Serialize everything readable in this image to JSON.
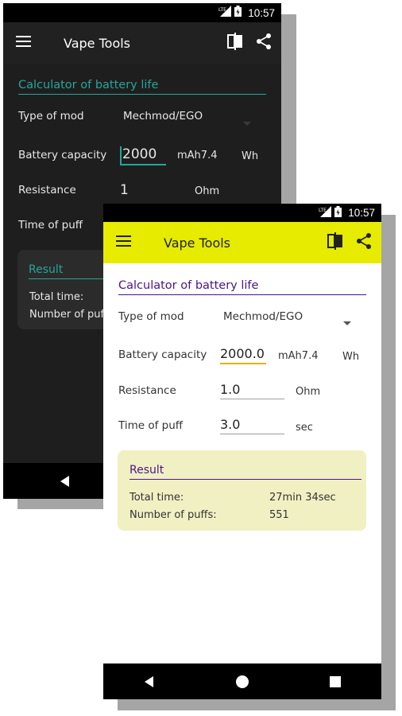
{
  "dark_screen": {
    "status_bar": {
      "time": "10:57",
      "network": "LTE"
    },
    "app_title": "Vape Tools",
    "icons": {
      "menu": "menu-icon",
      "compare": "compare-icon",
      "share": "share-icon"
    },
    "section_title": "Calculator of battery life",
    "type_of_mod": {
      "label": "Type of mod",
      "value": "Mechmod/EGO"
    },
    "battery_capacity": {
      "label": "Battery capacity",
      "value": "2000",
      "unit_mah": "mAh",
      "wh_value": "7.4",
      "unit_wh": "Wh"
    },
    "resistance": {
      "label": "Resistance",
      "value": "1",
      "unit": "Ohm"
    },
    "time_of_puff": {
      "label": "Time of puff"
    },
    "result": {
      "title": "Result",
      "total_time_label": "Total time:",
      "puffs_label": "Number of puffs:"
    },
    "colors": {
      "accent": "#26a69a",
      "background": "#1e1e1e"
    }
  },
  "light_screen": {
    "status_bar": {
      "time": "10:57",
      "network": "LTE"
    },
    "app_title": "Vape Tools",
    "icons": {
      "menu": "menu-icon",
      "compare": "compare-icon",
      "share": "share-icon"
    },
    "section_title": "Calculator of battery life",
    "type_of_mod": {
      "label": "Type of mod",
      "value": "Mechmod/EGO"
    },
    "battery_capacity": {
      "label": "Battery capacity",
      "value": "2000.0",
      "unit_mah": "mAh",
      "wh_value": "7.4",
      "unit_wh": "Wh"
    },
    "resistance": {
      "label": "Resistance",
      "value": "1.0",
      "unit": "Ohm"
    },
    "time_of_puff": {
      "label": "Time of puff",
      "value": "3.0",
      "unit": "sec"
    },
    "result": {
      "title": "Result",
      "total_time_label": "Total time:",
      "total_time_value": "27min 34sec",
      "puffs_label": "Number of puffs:",
      "puffs_value": "551"
    },
    "colors": {
      "toolbar": "#e6eb00",
      "accent": "#4a148c",
      "result_bg": "#f1f0c3"
    }
  }
}
